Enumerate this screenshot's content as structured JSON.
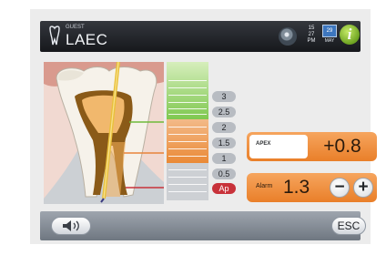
{
  "header": {
    "user_small": "GUEST",
    "user_name": "LAEC",
    "time": [
      "15",
      "27",
      "PM"
    ],
    "calendar_day": "29",
    "calendar_month": "MAY",
    "info_glyph": "i",
    "icons": [
      "tooth-logo-icon",
      "motor-icon",
      "calendar-icon",
      "info-icon"
    ]
  },
  "scale": {
    "ticks": [
      "3",
      "2.5",
      "2",
      "1.5",
      "1",
      "0.5",
      "Ap"
    ],
    "zones": [
      "green",
      "orange",
      "gray"
    ]
  },
  "apex": {
    "label": "APEX",
    "value": "+0.8"
  },
  "alarm": {
    "label": "Alarm",
    "value": "1.3",
    "minus": "−",
    "plus": "+"
  },
  "bottom": {
    "sound_icon": "speaker-icon",
    "esc_label": "ESC"
  },
  "colors": {
    "accent_orange": "#ee8a33",
    "apex_red": "#c8323a",
    "scale_green": "#7fc850",
    "info_green": "#8fc23a"
  }
}
